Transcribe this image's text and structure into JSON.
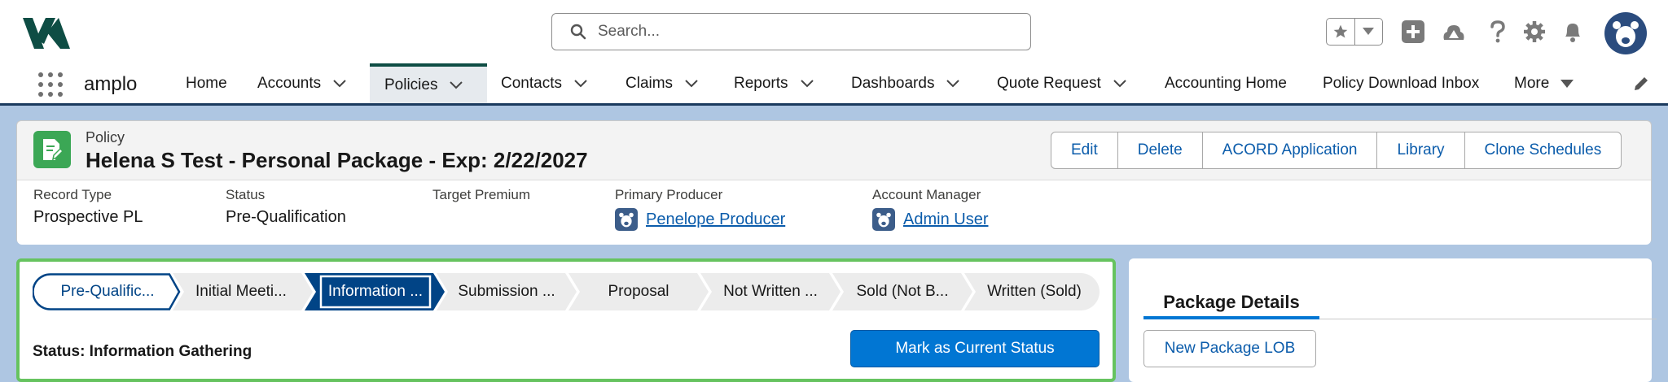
{
  "header": {
    "search_placeholder": "Search...",
    "icons": [
      "star-icon",
      "chevron-down-icon",
      "plus-icon",
      "trailhead-icon",
      "help-icon",
      "gear-icon",
      "bell-icon",
      "avatar"
    ]
  },
  "nav": {
    "app_name": "amplo",
    "items": [
      {
        "label": "Home",
        "has_menu": false
      },
      {
        "label": "Accounts",
        "has_menu": true
      },
      {
        "label": "Policies",
        "has_menu": true,
        "active": true
      },
      {
        "label": "Contacts",
        "has_menu": true
      },
      {
        "label": "Claims",
        "has_menu": true
      },
      {
        "label": "Reports",
        "has_menu": true
      },
      {
        "label": "Dashboards",
        "has_menu": true
      },
      {
        "label": "Quote Request",
        "has_menu": true
      },
      {
        "label": "Accounting Home",
        "has_menu": false
      },
      {
        "label": "Policy Download Inbox",
        "has_menu": false
      },
      {
        "label": "More",
        "has_menu": true
      }
    ]
  },
  "record": {
    "object_label": "Policy",
    "title": "Helena S Test - Personal Package - Exp: 2/22/2027",
    "actions": [
      "Edit",
      "Delete",
      "ACORD Application",
      "Library",
      "Clone Schedules"
    ],
    "fields": [
      {
        "label": "Record Type",
        "value": "Prospective PL"
      },
      {
        "label": "Status",
        "value": "Pre-Qualification"
      },
      {
        "label": "Target Premium",
        "value": ""
      },
      {
        "label": "Primary Producer",
        "value": "Penelope Producer"
      },
      {
        "label": "Account Manager",
        "value": "Admin User"
      }
    ]
  },
  "path": {
    "stages": [
      "Pre-Qualific...",
      "Initial Meeti...",
      "Information ...",
      "Submission ...",
      "Proposal",
      "Not Written ...",
      "Sold (Not B...",
      "Written (Sold)"
    ],
    "completed_stage": 0,
    "current_stage": 2,
    "status_text": "Status: Information Gathering",
    "mark_button": "Mark as Current Status"
  },
  "package": {
    "tab_label": "Package Details",
    "new_button": "New Package LOB"
  },
  "colors": {
    "brand_dark": "#0e4d44",
    "accent_blue": "#0176d3",
    "link_blue": "#0b5cab",
    "current_stage": "#014486",
    "record_icon": "#3ba755",
    "panel_border": "#66c35f"
  }
}
